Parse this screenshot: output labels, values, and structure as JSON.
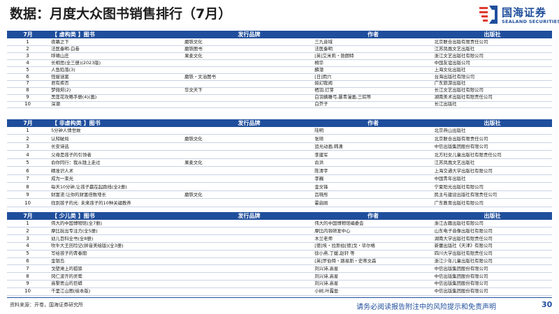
{
  "title": "数据：月度大众图书销售排行（7月）",
  "logo": {
    "cn": "国海证券",
    "en": "SEALAND SECURITIES"
  },
  "sections": [
    {
      "month": "7月",
      "category": "【 虚构类 】图书",
      "brand_header": "发行品牌",
      "author_header": "作者",
      "publisher_header": "出版社",
      "rows": [
        {
          "rank": "1",
          "title": "夜幕之下",
          "brand": "磨铁文化",
          "author": "三九音域",
          "publisher": "北京联合出版有限责任公司"
        },
        {
          "rank": "2",
          "title": "法医秦明-白卷",
          "brand": "磨铁图书",
          "author": "法医秦明",
          "publisher": "江苏凤凰文艺出版社"
        },
        {
          "rank": "3",
          "title": "呼啸山庄",
          "brand": "果麦文化",
          "author": "[英]艾米莉・勃朗特",
          "publisher": "浙江文艺出版社有限公司"
        },
        {
          "rank": "4",
          "title": "长相思(全三册)(2023版)",
          "brand": "",
          "author": "桐华",
          "publisher": "中国友谊出版公司"
        },
        {
          "rank": "5",
          "title": "人鱼陷落(3)",
          "brand": "",
          "author": "麟潜",
          "publisher": "上海文化出版社"
        },
        {
          "rank": "6",
          "title": "怪屋谜案",
          "brand": "磨铁・文治图书",
          "author": "[日]雨穴",
          "publisher": "台海出版社有限公司"
        },
        {
          "rank": "7",
          "title": "君有疾否",
          "brand": "",
          "author": "姒幻我闻",
          "publisher": "广东旅游出版社"
        },
        {
          "rank": "8",
          "title": "梦微烬(2)",
          "brand": "华文天下",
          "author": "栖羽,灯芽",
          "publisher": "长江文艺出版社有限公司"
        },
        {
          "rank": "9",
          "title": "黑莲花攻略手册(4)(画)",
          "brand": "",
          "author": "白羽摘雕弓,暴青漫画,三皖等",
          "publisher": "湖南美术出版社有限责任公司"
        },
        {
          "rank": "10",
          "title": "深潮",
          "brand": "",
          "author": "白芥子",
          "publisher": "长江出版社"
        }
      ]
    },
    {
      "month": "7月",
      "category": "【 非虚构类 】图书",
      "brand_header": "发行品牌",
      "author_header": "作者",
      "publisher_header": "出版社",
      "rows": [
        {
          "rank": "1",
          "title": "5分钟人情世故",
          "brand": "",
          "author": "陆明",
          "publisher": "北京燕山出版社"
        },
        {
          "rank": "2",
          "title": "认知破局",
          "brand": "磨铁文化",
          "author": "张琦",
          "publisher": "北京联合出版有限责任公司"
        },
        {
          "rank": "3",
          "title": "长安诗选",
          "brand": "",
          "author": "追光动画,韩潇",
          "publisher": "中信出版集团股份有限公司"
        },
        {
          "rank": "4",
          "title": "父母是孩子的引领者",
          "brand": "",
          "author": "李建军",
          "publisher": "北方妇女儿童出版社有限责任公司"
        },
        {
          "rank": "5",
          "title": "俞你同行：我从陇上走过",
          "brand": "果麦文化",
          "author": "俞洪",
          "publisher": "江苏凤凰文艺出版社"
        },
        {
          "rank": "6",
          "title": "精准识人术",
          "brand": "",
          "author": "陈清宇",
          "publisher": "上海交通大学出版社有限公司"
        },
        {
          "rank": "7",
          "title": "成为一束光",
          "brand": "",
          "author": "李巍",
          "publisher": "中国青年出版社"
        },
        {
          "rank": "8",
          "title": "每天10分钟,让孩子赢在起跑线(全2册)",
          "brand": "",
          "author": "金文锋",
          "publisher": "宁夏阳光出版社有限公司"
        },
        {
          "rank": "9",
          "title": "财富流:让你的财富倍数增长",
          "brand": "磨铁文化",
          "author": "吕晓彤",
          "publisher": "民主与建设出版社有限责任公司"
        },
        {
          "rank": "10",
          "title": "找到孩子的光: 未来孩子的10种关键教养",
          "brand": "",
          "author": "霍启刚",
          "publisher": "广东教育出版社有限公司"
        }
      ]
    },
    {
      "month": "7月",
      "category": "【 少儿类 】图书",
      "brand_header": "发行品牌",
      "author_header": "作者",
      "publisher_header": "出版社",
      "rows": [
        {
          "rank": "1",
          "title": "伟大的中国博物馆(全7册)",
          "brand": "",
          "author": "伟大的中国博物馆编委会",
          "publisher": "浙江古籍出版社有限公司"
        },
        {
          "rank": "2",
          "title": "摩比玩出专注力(全5册)",
          "brand": "",
          "author": "摩比内容研发中心",
          "publisher": "山东电子音像出版社有限公司"
        },
        {
          "rank": "3",
          "title": "幼儿百科全书(全8册)",
          "brand": "",
          "author": "木兰老师",
          "publisher": "湖南大学出版社有限责任公司"
        },
        {
          "rank": "4",
          "title": "吹牛大王历险记(拼音美绘版)(全3册)",
          "brand": "",
          "author": "[德]埃・拉斯伯[德]戈・毕尔格",
          "publisher": "新蕾出版社《天津》有限公司"
        },
        {
          "rank": "5",
          "title": "写给孩子的青春期",
          "brand": "",
          "author": "徐小燕,丁媛,赵轩 等",
          "publisher": "四川大学出版社有限责任公司"
        },
        {
          "rank": "6",
          "title": "金银岛",
          "brand": "",
          "author": "[英]罗伯特・路易斯・史蒂文森",
          "publisher": "浙江少年儿童出版社有限公司"
        },
        {
          "rank": "7",
          "title": "戈壁滩上的孤狼",
          "brand": "",
          "author": "刘兴诗,高星",
          "publisher": "中信出版集团股份有限公司"
        },
        {
          "rank": "8",
          "title": "冈仁波齐的灵鹫",
          "brand": "",
          "author": "刘兴诗,高星",
          "publisher": "中信出版集团股份有限公司"
        },
        {
          "rank": "9",
          "title": "高黎贡山的巨蟒",
          "brand": "",
          "author": "刘兴诗,高星",
          "publisher": "中信出版集团股份有限公司"
        },
        {
          "rank": "10",
          "title": "千里江山图(绘本版)",
          "brand": "",
          "author": "小树,叶露盈",
          "publisher": "中信出版集团股份有限公司"
        }
      ]
    }
  ],
  "footer": {
    "source": "资料来源：开卷，国海证券研究所",
    "disclaimer": "请务必阅读报告附注中的风险提示和免责声明",
    "page": "30"
  }
}
